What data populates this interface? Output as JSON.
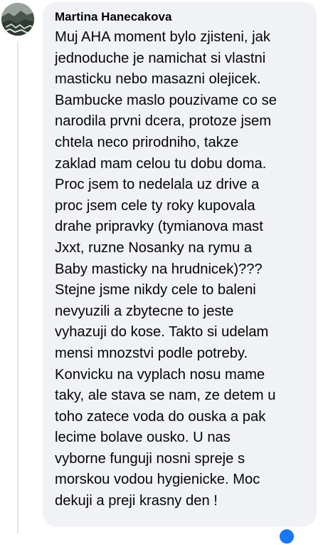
{
  "comment": {
    "author": "Martina Hanecakova",
    "avatar_icon": "profile-photo-avatar",
    "lines": [
      "Muj AHA moment bylo zjisteni, jak",
      "jednoduche je namichat si vlastni",
      "masticku nebo masazni olejicek.",
      "Bambucke maslo pouzivame co se",
      "narodila prvni dcera, protoze jsem",
      "chtela neco prirodniho, takze",
      "zaklad mam celou tu dobu doma.",
      "Proc jsem to nedelala uz drive a",
      "proc jsem cele ty roky kupovala",
      "drahe pripravky (tymianova mast",
      "Jxxt, ruzne Nosanky na rymu a",
      "Baby masticky na hrudnicek)???",
      "Stejne jsme nikdy cele to baleni",
      "nevyuzili a zbytecne to jeste",
      "vyhazuji do kose. Takto si udelam",
      "mensi mnozstvi podle potreby.",
      "Konvicku na vyplach nosu mame",
      "taky, ale stava se nam, ze detem u",
      "toho zatece voda do ouska a pak",
      "lecime bolave ousko. U nas",
      "vyborne funguji nosni spreje s",
      "morskou vodou hygienicke. Moc",
      "dekuji a preji krasny den !"
    ]
  },
  "colors": {
    "bubble_background": "#f0f2f5",
    "text": "#050505",
    "thread_line": "#e4e6eb",
    "reaction_accent": "#1877f2"
  }
}
